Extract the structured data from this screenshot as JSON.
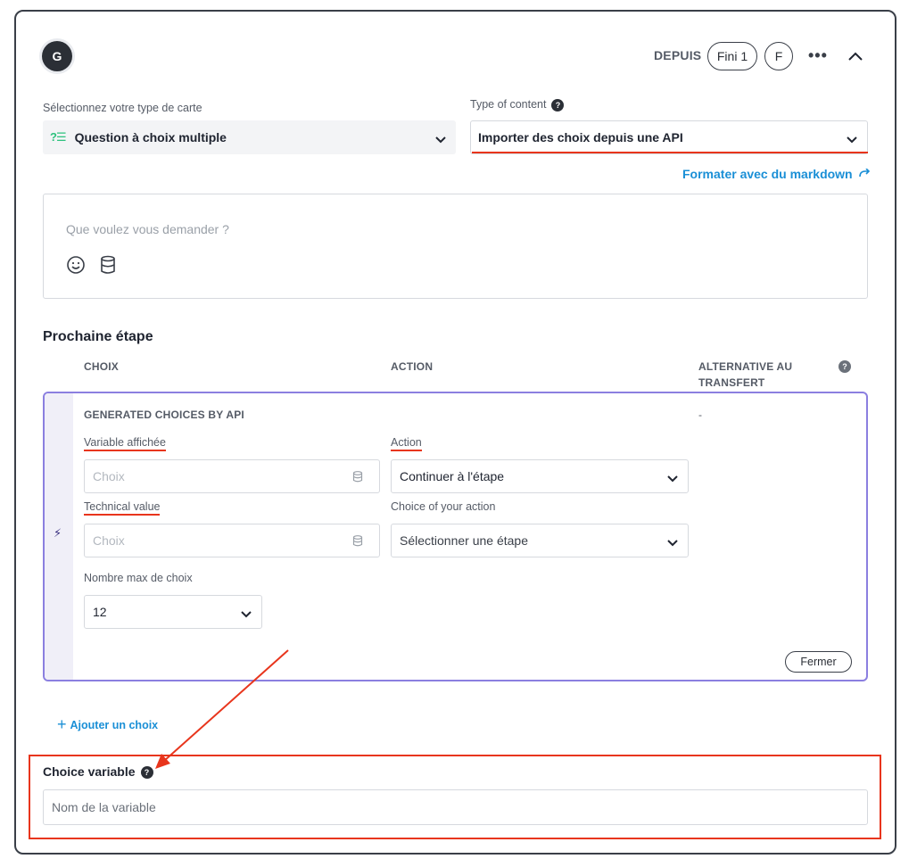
{
  "header": {
    "avatar_letter": "G",
    "depuis_label": "DEPUIS",
    "source_pill": "Fini 1",
    "letter_pill": "F"
  },
  "card_type": {
    "label": "Sélectionnez votre type de carte",
    "value": "Question à choix multiple",
    "icon": "question-list-icon"
  },
  "content_type": {
    "label": "Type of content",
    "help": "?",
    "value": "Importer des choix depuis une API"
  },
  "markdown_link": "Formater avec du markdown",
  "question": {
    "placeholder": "Que voulez vous demander ?"
  },
  "next_step": {
    "title": "Prochaine étape",
    "columns": {
      "choix": "CHOIX",
      "action": "ACTION",
      "alt_line1": "ALTERNATIVE AU",
      "alt_line2": "TRANSFERT"
    },
    "help": "?"
  },
  "generated": {
    "title": "GENERATED CHOICES BY API",
    "alt_value": "-",
    "variable_label": "Variable affichée",
    "variable_placeholder": "Choix",
    "technical_label": "Technical value",
    "technical_placeholder": "Choix",
    "action_label": "Action",
    "action_value": "Continuer à l'étape",
    "choice_action_label": "Choice of your action",
    "choice_action_value": "Sélectionner une étape",
    "max_label": "Nombre max de choix",
    "max_value": "12",
    "close_button": "Fermer"
  },
  "add_choice": "Ajouter un choix",
  "choice_variable": {
    "label": "Choice variable",
    "help": "?",
    "placeholder": "Nom de la variable"
  },
  "colors": {
    "accent_blue": "#1a8fd6",
    "annotation_red": "#e8351c",
    "purple_border": "#8b7fe0",
    "green_icon": "#2ec27e"
  }
}
